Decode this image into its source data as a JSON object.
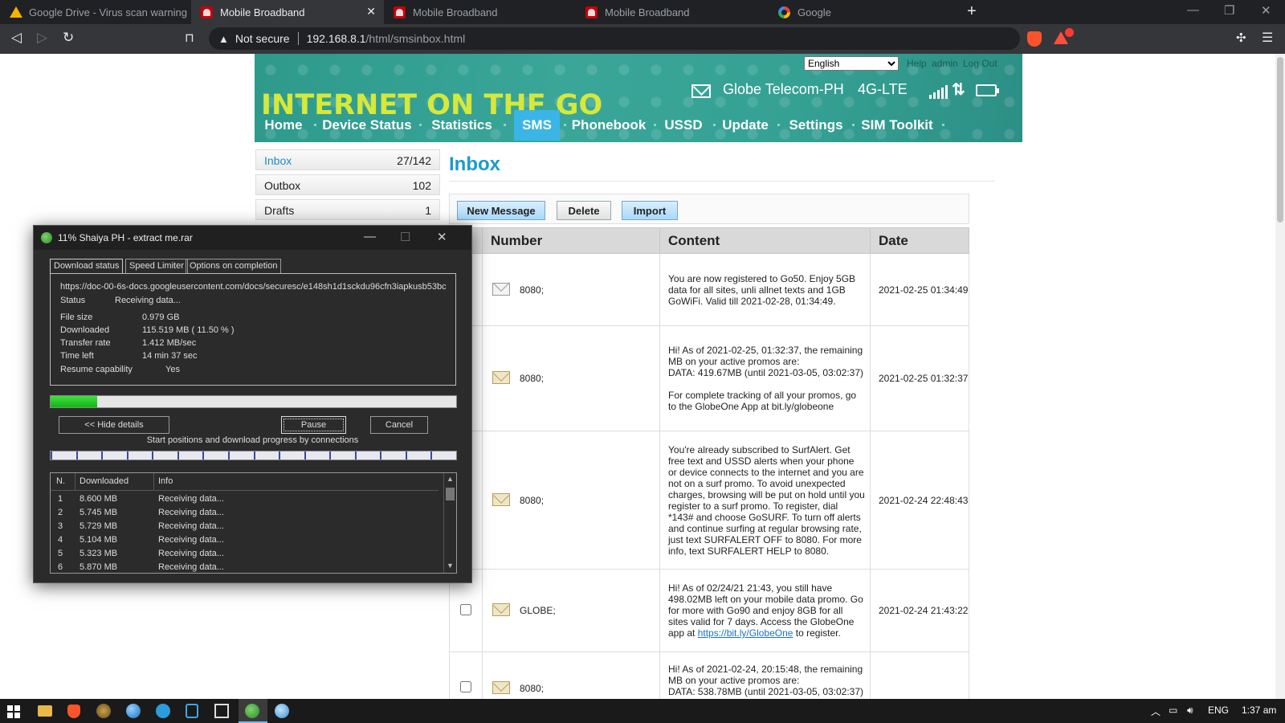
{
  "browser": {
    "tabs": [
      {
        "title": "Google Drive - Virus scan warning",
        "icon": "google-drive-icon",
        "active": false
      },
      {
        "title": "Mobile Broadband",
        "icon": "huawei-icon",
        "active": true
      },
      {
        "title": "Mobile Broadband",
        "icon": "huawei-icon",
        "active": false
      },
      {
        "title": "Mobile Broadband",
        "icon": "huawei-icon",
        "active": false
      },
      {
        "title": "Google",
        "icon": "google-icon",
        "active": false
      }
    ],
    "security_label": "Not secure",
    "url_host": "192.168.8.1",
    "url_path": "/html/smsinbox.html",
    "badge_count": "1"
  },
  "header": {
    "banner_title": "INTERNET ON THE GO",
    "language": "English",
    "language_options": [
      "English"
    ],
    "links": [
      "Help",
      "admin",
      "Log Out"
    ],
    "operator": "Globe Telecom-PH",
    "network_type": "4G-LTE"
  },
  "nav": {
    "items": [
      "Home",
      "Device Status",
      "Statistics",
      "SMS",
      "Phonebook",
      "USSD",
      "Update",
      "Settings",
      "SIM Toolkit"
    ],
    "active": "SMS"
  },
  "sidebar": {
    "items": [
      {
        "label": "Inbox",
        "count": "27/142"
      },
      {
        "label": "Outbox",
        "count": "102"
      },
      {
        "label": "Drafts",
        "count": "1"
      }
    ]
  },
  "inbox": {
    "title": "Inbox",
    "buttons": {
      "new": "New Message",
      "delete": "Delete",
      "import": "Import"
    },
    "columns": [
      "Number",
      "Content",
      "Date"
    ],
    "rows": [
      {
        "number": "8080;",
        "read": true,
        "content": "You are now registered to Go50. Enjoy 5GB data for all sites, unli allnet texts and 1GB GoWiFi. Valid till 2021-02-28, 01:34:49.",
        "date": "2021-02-25 01:34:49"
      },
      {
        "number": "8080;",
        "read": false,
        "content_lines": [
          "Hi! As of 2021-02-25, 01:32:37, the remaining MB on your active promos are:",
          "DATA: 419.67MB (until 2021-03-05, 03:02:37)",
          "",
          "For complete tracking of all your promos, go to the GlobeOne App at bit.ly/globeone"
        ],
        "date": "2021-02-25 01:32:37"
      },
      {
        "number": "8080;",
        "read": false,
        "content": "You're already subscribed to SurfAlert. Get free text and USSD alerts when your phone or device connects to the internet and you are not on a surf promo. To avoid unexpected charges, browsing will be put on hold until you register to a surf promo. To register, dial *143# and choose GoSURF. To turn off alerts and continue surfing at regular browsing rate, just text SURFALERT OFF to 8080. For more info, text SURFALERT HELP to 8080.",
        "date": "2021-02-24 22:48:43"
      },
      {
        "number": "GLOBE;",
        "read": false,
        "content_before": "Hi! As of 02/24/21 21:43, you still have 498.02MB left on your mobile data promo. Go for more with Go90 and enjoy 8GB for all sites valid for 7 days. Access the GlobeOne app at ",
        "content_link": "https://bit.ly/GlobeOne",
        "content_after": " to register.",
        "date": "2021-02-24 21:43:22"
      },
      {
        "number": "8080;",
        "read": false,
        "content_lines": [
          "Hi! As of 2021-02-24, 20:15:48, the remaining MB on your active promos are:",
          "DATA: 538.78MB (until 2021-03-05, 03:02:37)"
        ],
        "date": ""
      }
    ]
  },
  "idm": {
    "title": "11% Shaiya PH - extract me.rar",
    "tabs": [
      "Download status",
      "Speed Limiter",
      "Options on completion"
    ],
    "url": "https://doc-00-6s-docs.googleusercontent.com/docs/securesc/e148sh1d1sckdu96cfn3iapkusb53bc",
    "fields": [
      {
        "label": "Status",
        "value": "Receiving data..."
      },
      {
        "label": "File size",
        "value": "0.979  GB"
      },
      {
        "label": "Downloaded",
        "value": "115.519  MB  ( 11.50 % )"
      },
      {
        "label": "Transfer rate",
        "value": "1.412  MB/sec"
      },
      {
        "label": "Time left",
        "value": "14 min 37 sec"
      },
      {
        "label": "Resume capability",
        "value": "Yes"
      }
    ],
    "progress": 0.115,
    "buttons": {
      "hide": "<< Hide details",
      "pause": "Pause",
      "cancel": "Cancel"
    },
    "connections_label": "Start positions and download progress by connections",
    "list_columns": [
      "N.",
      "Downloaded",
      "Info"
    ],
    "connections": [
      {
        "n": "1",
        "downloaded": "8.600  MB",
        "info": "Receiving data..."
      },
      {
        "n": "2",
        "downloaded": "5.745  MB",
        "info": "Receiving data..."
      },
      {
        "n": "3",
        "downloaded": "5.729  MB",
        "info": "Receiving data..."
      },
      {
        "n": "4",
        "downloaded": "5.104  MB",
        "info": "Receiving data..."
      },
      {
        "n": "5",
        "downloaded": "5.323  MB",
        "info": "Receiving data..."
      },
      {
        "n": "6",
        "downloaded": "5.870  MB",
        "info": "Receiving data..."
      }
    ]
  },
  "taskbar": {
    "language": "ENG",
    "time": "1:37 am"
  },
  "colors": {
    "accent_blue": "#1a9bd0",
    "banner_teal": "#35a194",
    "banner_title_yellow": "#d6e83a",
    "idm_progress_green": "#14b414"
  }
}
